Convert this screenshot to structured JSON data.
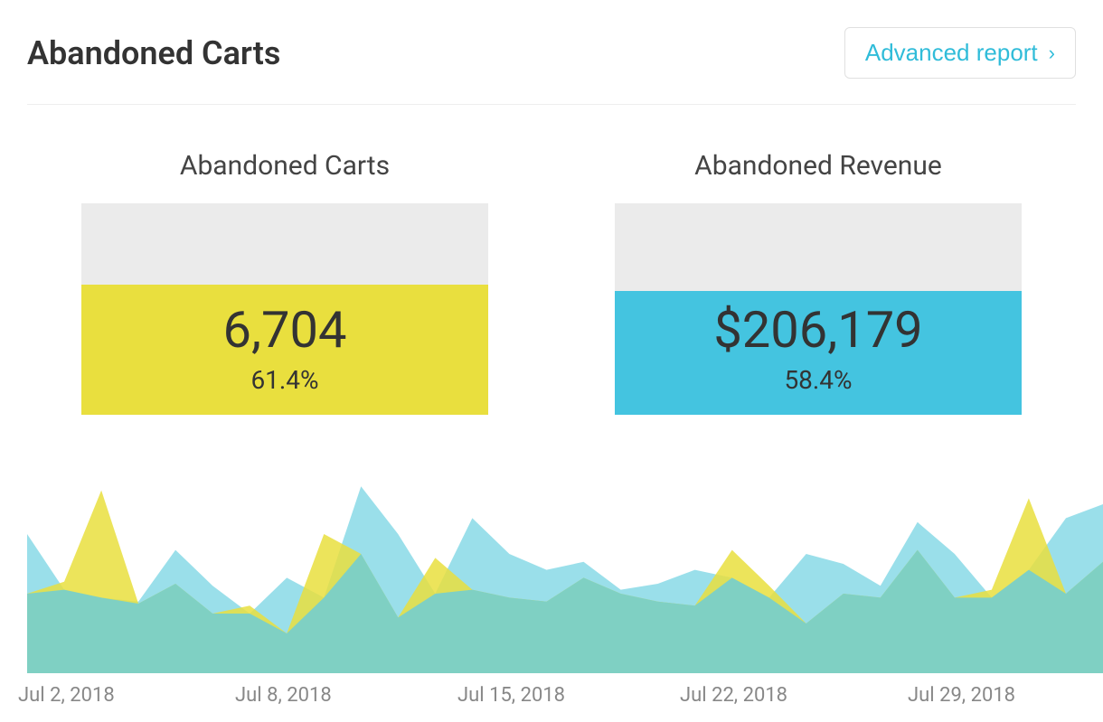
{
  "header": {
    "title": "Abandoned Carts",
    "advanced_report_label": "Advanced report"
  },
  "metrics": {
    "carts": {
      "label": "Abandoned Carts",
      "value": "6,704",
      "percent": "61.4%",
      "fill_pct": 61.4,
      "color": "#e9df3e"
    },
    "revenue": {
      "label": "Abandoned Revenue",
      "value": "$206,179",
      "percent": "58.4%",
      "fill_pct": 58.4,
      "color": "#44c4e0"
    }
  },
  "chart_data": {
    "type": "area",
    "xlabel": "",
    "ylabel": "",
    "x_ticks": [
      "Jul 2, 2018",
      "Jul 8, 2018",
      "Jul 15, 2018",
      "Jul 22, 2018",
      "Jul 29, 2018"
    ],
    "series": [
      {
        "name": "Abandoned Carts",
        "color": "#e9df3e",
        "values": [
          40,
          46,
          92,
          35,
          45,
          30,
          34,
          20,
          70,
          60,
          28,
          58,
          42,
          38,
          36,
          48,
          40,
          36,
          34,
          62,
          44,
          25,
          40,
          38,
          62,
          38,
          42,
          88,
          40,
          56
        ]
      },
      {
        "name": "Abandoned Revenue",
        "color": "#44c4e0",
        "values": [
          70,
          42,
          38,
          36,
          62,
          44,
          30,
          48,
          38,
          94,
          70,
          40,
          78,
          60,
          52,
          56,
          42,
          45,
          52,
          48,
          38,
          60,
          55,
          44,
          76,
          60,
          38,
          52,
          78,
          85
        ]
      }
    ],
    "ylim": [
      0,
      100
    ]
  },
  "colors": {
    "accent": "#30bcd9",
    "yellow": "#e9df3e",
    "teal": "#7fd0c3",
    "blue": "#44c4e0",
    "grey_bg": "#ebebeb"
  }
}
